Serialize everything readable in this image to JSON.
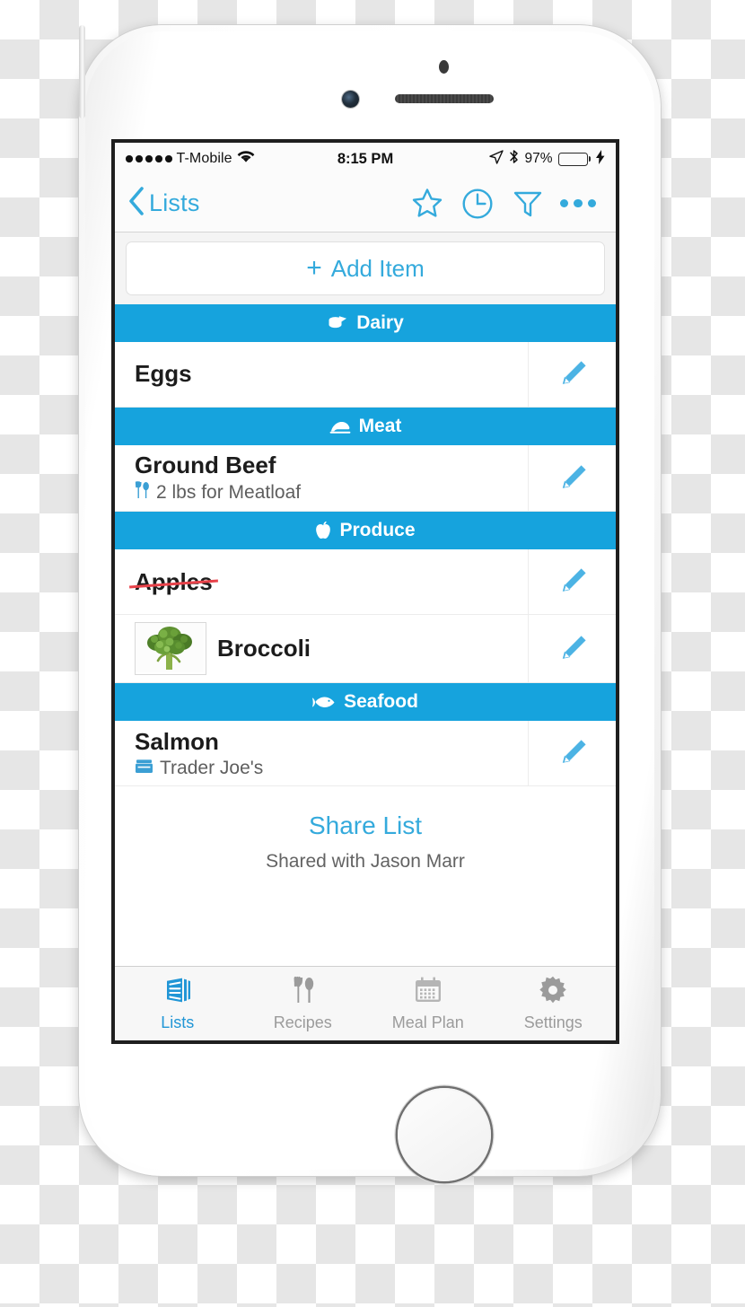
{
  "device": {
    "type": "iphone-white",
    "status_bar": {
      "carrier": "T-Mobile",
      "signal_dots": 5,
      "wifi_icon": "wifi-icon",
      "time": "8:15 PM",
      "location_icon": "location-arrow-icon",
      "bluetooth_icon": "bluetooth-icon",
      "battery_percent": "97%",
      "battery_level": 97,
      "charging": true,
      "battery_color": "#4cd964"
    }
  },
  "theme": {
    "accent": "#34aadc",
    "section_header_bg": "#16a3dd",
    "strike_color": "#e8424a",
    "tab_active": "#2196d6",
    "tab_inactive": "#9b9b9b"
  },
  "nav_bar": {
    "back_label": "Lists",
    "back_icon": "chevron-left-icon",
    "actions": [
      {
        "name": "favorite-star-icon",
        "icon": "star-icon"
      },
      {
        "name": "recent-clock-icon",
        "icon": "clock-icon"
      },
      {
        "name": "filter-icon",
        "icon": "funnel-icon"
      },
      {
        "name": "more-options-icon",
        "icon": "ellipsis-icon"
      }
    ]
  },
  "add_item": {
    "plus": "+",
    "label": "Add Item"
  },
  "sections": [
    {
      "title": "Dairy",
      "icon": "cheese-icon",
      "items": [
        {
          "title": "Eggs",
          "subtitle": "",
          "subtitle_icon": "",
          "struck": false,
          "thumbnail": "",
          "edit_icon": "pencil-icon"
        }
      ]
    },
    {
      "title": "Meat",
      "icon": "steak-icon",
      "items": [
        {
          "title": "Ground Beef",
          "subtitle": "2 lbs for Meatloaf",
          "subtitle_icon": "utensils-icon",
          "struck": false,
          "thumbnail": "",
          "edit_icon": "pencil-icon"
        }
      ]
    },
    {
      "title": "Produce",
      "icon": "apple-icon",
      "items": [
        {
          "title": "Apples",
          "subtitle": "",
          "subtitle_icon": "",
          "struck": true,
          "thumbnail": "",
          "edit_icon": "pencil-icon"
        },
        {
          "title": "Broccoli",
          "subtitle": "",
          "subtitle_icon": "",
          "struck": false,
          "thumbnail": "broccoli-photo",
          "edit_icon": "pencil-icon"
        }
      ]
    },
    {
      "title": "Seafood",
      "icon": "fish-icon",
      "items": [
        {
          "title": "Salmon",
          "subtitle": "Trader Joe's",
          "subtitle_icon": "store-icon",
          "struck": false,
          "thumbnail": "",
          "edit_icon": "pencil-icon"
        }
      ]
    }
  ],
  "share": {
    "link_label": "Share List",
    "shared_with": "Shared with Jason Marr"
  },
  "tab_bar": {
    "tabs": [
      {
        "label": "Lists",
        "icon": "lists-icon",
        "active": true
      },
      {
        "label": "Recipes",
        "icon": "utensils-icon",
        "active": false
      },
      {
        "label": "Meal Plan",
        "icon": "calendar-icon",
        "active": false
      },
      {
        "label": "Settings",
        "icon": "gear-icon",
        "active": false
      }
    ]
  }
}
